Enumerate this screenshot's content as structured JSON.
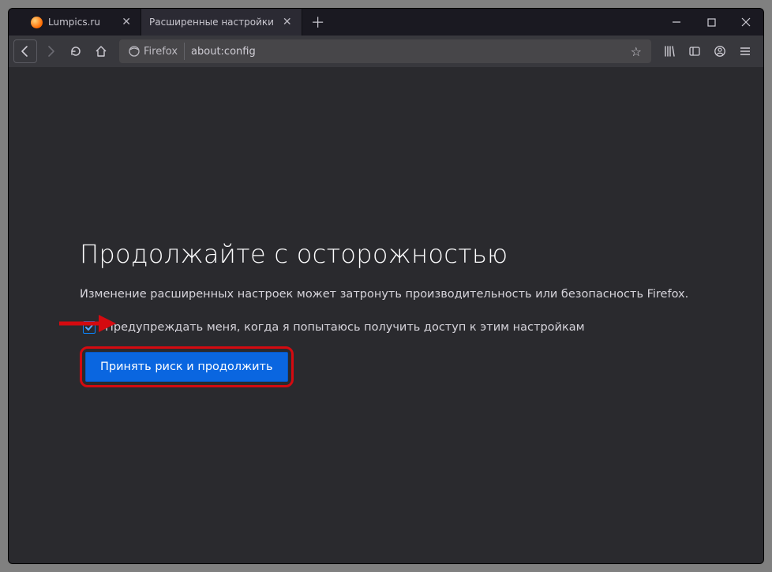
{
  "tabs": [
    {
      "title": "Lumpics.ru",
      "hasFavicon": true
    },
    {
      "title": "Расширенные настройки",
      "hasFavicon": false
    }
  ],
  "urlbar": {
    "identity_label": "Firefox",
    "url": "about:config"
  },
  "warning": {
    "heading": "Продолжайте с осторожностью",
    "description": "Изменение расширенных настроек может затронуть производительность или безопасность Firefox.",
    "checkbox_label": "Предупреждать меня, когда я попытаюсь получить доступ к этим настройкам",
    "accept_button": "Принять риск и продолжить"
  }
}
